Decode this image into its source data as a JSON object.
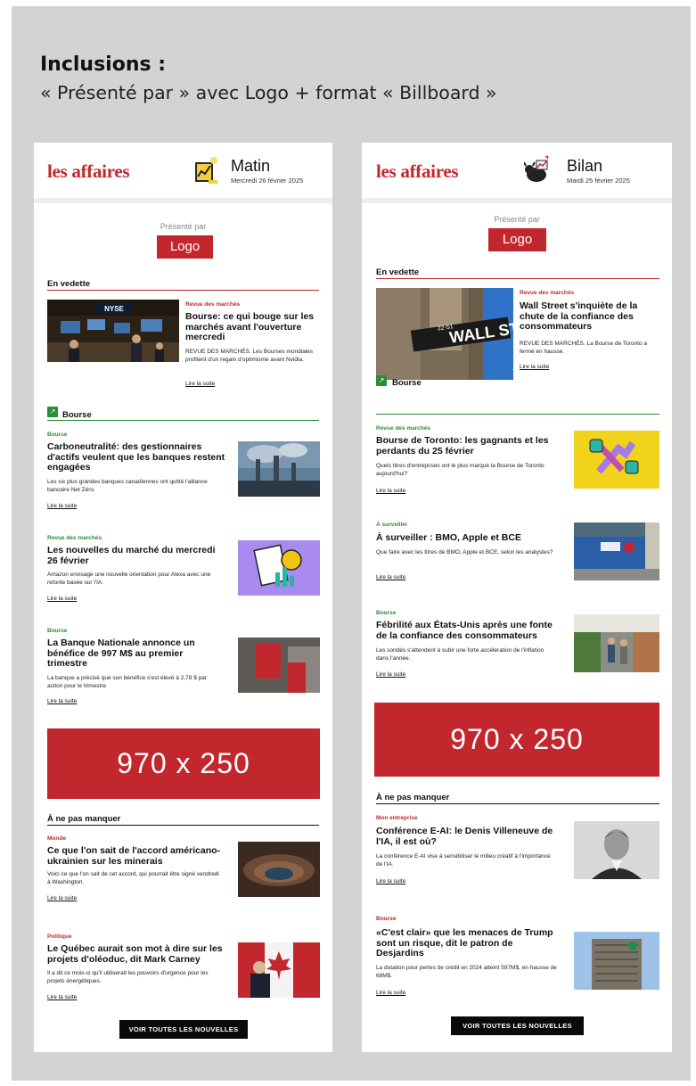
{
  "intro": {
    "heading": "Inclusions :",
    "subheading": "« Présenté par » avec Logo + format « Billboard »"
  },
  "colors": {
    "brand_red": "#c1272d",
    "bourse_green": "#2e8b3a",
    "panel_gray": "#d3d3d6"
  },
  "left": {
    "brand": "les affaires",
    "edition_icon": "chart-document-icon",
    "edition_name": "Matin",
    "edition_date": "Mercredi 26 février 2025",
    "presented_by": "Présenté par",
    "logo": "Logo",
    "featured": {
      "section": "En vedette",
      "kicker": "Revue des marchés",
      "title": "Bourse: ce qui bouge sur les marchés avant l'ouverture mercredi",
      "desc": "REVUE DES MARCHÉS. Les Bourses mondiales profitent d'un regain d'optimisme avant Nvidia.",
      "link": "Lire la suite",
      "image_label": "NYSE"
    },
    "bourse": {
      "section": "Bourse",
      "articles": [
        {
          "kicker": "Bourse",
          "title": "Carboneutralité: des gestionnaires d'actifs veulent que les banques restent engagées",
          "desc": "Les six plus grandes banques canadiennes ont quitté l'alliance bancaire Net Zéro.",
          "link": "Lire la suite"
        },
        {
          "kicker": "Revue des marchés",
          "title": "Les nouvelles du marché du mercredi 26 février",
          "desc": "Amazon envisage une nouvelle orientation pour Alexa avec une refonte basée sur l'IA.",
          "link": "Lire la suite"
        },
        {
          "kicker": "Bourse",
          "title": "La Banque Nationale annonce un bénéfice de 997 M$ au premier trimestre",
          "desc": "La banque a précisé que son bénéfice s'est élevé à 2,78 $ par action pour le trimestre",
          "link": "Lire la suite"
        }
      ]
    },
    "billboard": "970 x 250",
    "dontmiss": {
      "section": "À ne pas manquer",
      "articles": [
        {
          "kicker": "Monde",
          "title": "Ce que l'on sait de l'accord américano-ukrainien sur les minerais",
          "desc": "Voici ce que l'on sait de cet accord, qui pourrait être signé vendredi à Washington.",
          "link": "Lire la suite"
        },
        {
          "kicker": "Politique",
          "title": "Le Québec aurait son mot à dire sur les projets d'oléoduc, dit Mark Carney",
          "desc": "Il a dit ce mois-ci qu'il utiliserait les pouvoirs d'urgence pour les projets énergétiques.",
          "link": "Lire la suite"
        }
      ]
    },
    "cta": "VOIR TOUTES LES NOUVELLES"
  },
  "right": {
    "brand": "les affaires",
    "edition_icon": "bull-chart-icon",
    "edition_name": "Bilan",
    "edition_date": "Mardi 25 février 2025",
    "presented_by": "Présenté par",
    "logo": "Logo",
    "featured": {
      "section": "En vedette",
      "kicker": "Revue des marchés",
      "title": "Wall Street s'inquiète de la chute de la confiance des consommateurs",
      "desc": "REVUE DES MARCHÉS. La Bourse de Toronto a fermé en hausse.",
      "link": "Lire la suite",
      "image_label": "WALL ST",
      "image_number": "22-51"
    },
    "bourse": {
      "section": "Bourse",
      "articles": [
        {
          "kicker": "Revue des marchés",
          "title": "Bourse de Toronto: les gagnants et les perdants du 25 février",
          "desc": "Quels titres d'entreprises ont le plus marqué la Bourse de Toronto aujourd'hui?",
          "link": "Lire la suite"
        },
        {
          "kicker": "À surveiller",
          "title": "À surveiller : BMO, Apple et BCE",
          "desc": "Que faire avec les titres de BMO, Apple et BCE, selon les analystes?",
          "link": "Lire la suite"
        },
        {
          "kicker": "Bourse",
          "title": "Fébrilité aux États-Unis après une fonte de la confiance des consommateurs",
          "desc": "Les sondés s'attendent à subir une forte accélération de l'inflation dans l'année.",
          "link": "Lire la suite"
        }
      ]
    },
    "billboard": "970 x 250",
    "dontmiss": {
      "section": "À ne pas manquer",
      "articles": [
        {
          "kicker": "Mon entreprise",
          "title": "Conférence E-AI: le Denis Villeneuve de l'IA, il est où?",
          "desc": "La conférence E-AI vise à sensibiliser le milieu créatif à l'importance de l'IA.",
          "link": "Lire la suite"
        },
        {
          "kicker": "Bourse",
          "title": "«C'est clair» que les menaces de Trump sont un risque, dit le patron de Desjardins",
          "desc": "La dotation pour pertes de crédit en 2024 atteint 597M$, en hausse de 68M$.",
          "link": "Lire la suite"
        }
      ]
    },
    "cta": "VOIR TOUTES LES NOUVELLES"
  }
}
